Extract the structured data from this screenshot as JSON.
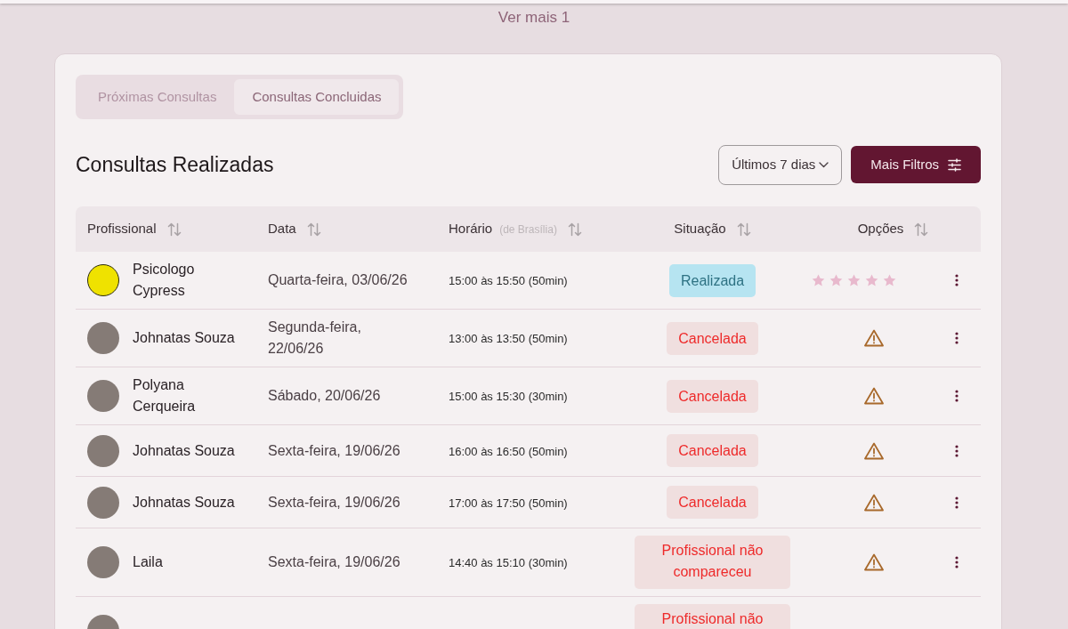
{
  "more_link": {
    "text": "Ver mais 1"
  },
  "tabs": [
    {
      "label": "Próximas Consultas",
      "selected": false
    },
    {
      "label": "Consultas Concluidas",
      "selected": true
    }
  ],
  "section": {
    "title": "Consultas Realizadas"
  },
  "filters": {
    "period": {
      "value": "Últimos 7 dias"
    },
    "more_button": {
      "label": "Mais Filtros"
    }
  },
  "table": {
    "columns": [
      {
        "label": "Profissional"
      },
      {
        "label": "Data"
      },
      {
        "label": "Horário",
        "note": "(de Brasília)"
      },
      {
        "label": "Situação"
      },
      {
        "label": "Opções"
      }
    ],
    "rows": [
      {
        "avatar": {
          "kind": "sign"
        },
        "name": "Psicologo Cypress",
        "date": "Quarta-feira, 03/06/26",
        "time": "15:00 às 15:50 (50min)",
        "status": {
          "kind": "done",
          "text": "Realizada"
        },
        "options": {
          "kind": "rating",
          "stars": 5
        }
      },
      {
        "avatar": {
          "kind": "photo"
        },
        "name": "Johnatas Souza",
        "date": "Segunda-feira, 22/06/26",
        "time": "13:00 às 13:50 (50min)",
        "status": {
          "kind": "cancelled",
          "text": "Cancelada"
        },
        "options": {
          "kind": "warning"
        }
      },
      {
        "avatar": {
          "kind": "photo"
        },
        "name": "Polyana Cerqueira",
        "date": "Sábado, 20/06/26",
        "time": "15:00 às 15:30 (30min)",
        "status": {
          "kind": "cancelled",
          "text": "Cancelada"
        },
        "options": {
          "kind": "warning"
        }
      },
      {
        "avatar": {
          "kind": "photo"
        },
        "name": "Johnatas Souza",
        "date": "Sexta-feira, 19/06/26",
        "time": "16:00 às 16:50 (50min)",
        "status": {
          "kind": "cancelled",
          "text": "Cancelada"
        },
        "options": {
          "kind": "warning"
        }
      },
      {
        "avatar": {
          "kind": "photo"
        },
        "name": "Johnatas Souza",
        "date": "Sexta-feira, 19/06/26",
        "time": "17:00 às 17:50 (50min)",
        "status": {
          "kind": "cancelled",
          "text": "Cancelada"
        },
        "options": {
          "kind": "warning"
        }
      },
      {
        "avatar": {
          "kind": "photo"
        },
        "name": "Laila",
        "date": "Sexta-feira, 19/06/26",
        "time": "14:40 às 15:10 (30min)",
        "status": {
          "kind": "no_show",
          "text": "Profissional não compareceu"
        },
        "options": {
          "kind": "warning"
        }
      },
      {
        "avatar": {
          "kind": "photo"
        },
        "status": {
          "kind": "no_show",
          "text": "Profissional não"
        }
      }
    ]
  }
}
